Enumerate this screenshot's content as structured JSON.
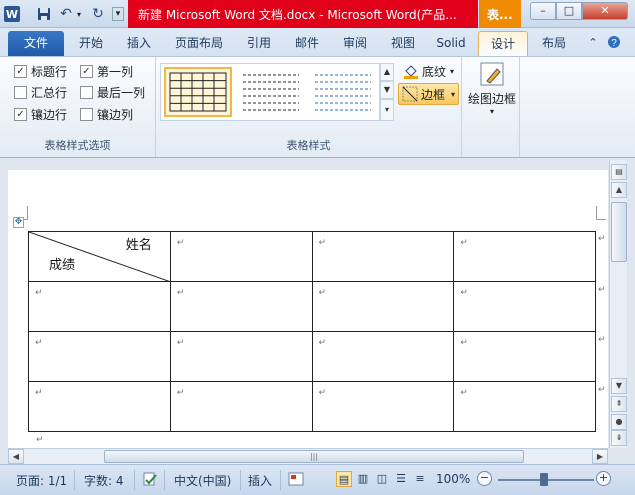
{
  "app": {
    "title": "新建 Microsoft Word 文档.docx - Microsoft Word(产品...",
    "context_tab": "表..."
  },
  "window_controls": {
    "minimize": "–",
    "maximize": "□",
    "close": "✕"
  },
  "quick_access": {
    "more": "▾"
  },
  "tabs": [
    {
      "label": "文件"
    },
    {
      "label": "开始"
    },
    {
      "label": "插入"
    },
    {
      "label": "页面布局"
    },
    {
      "label": "引用"
    },
    {
      "label": "邮件"
    },
    {
      "label": "审阅"
    },
    {
      "label": "视图"
    },
    {
      "label": "Solid"
    },
    {
      "label": "设计"
    },
    {
      "label": "布局"
    }
  ],
  "ribbon": {
    "style_options": {
      "label": "表格样式选项",
      "checkboxes": [
        {
          "label": "标题行",
          "checked": true
        },
        {
          "label": "第一列",
          "checked": true
        },
        {
          "label": "汇总行",
          "checked": false
        },
        {
          "label": "最后一列",
          "checked": false
        },
        {
          "label": "镶边行",
          "checked": true
        },
        {
          "label": "镶边列",
          "checked": false
        }
      ]
    },
    "table_styles": {
      "label": "表格样式",
      "shading_label": "底纹",
      "borders_label": "边框"
    },
    "draw_borders": {
      "label": "绘图边框"
    }
  },
  "document": {
    "header_cell": {
      "name": "姓名",
      "score": "成绩"
    },
    "paragraph_mark": "↵",
    "rows": 4,
    "cols": 4
  },
  "status": {
    "page": "页面: 1/1",
    "words": "字数: 4",
    "language": "中文(中国)",
    "mode": "插入",
    "zoom": "100%",
    "zoom_minus": "−",
    "zoom_plus": "+"
  },
  "colors": {
    "title_red": "#e0001a",
    "context_orange": "#f08a00",
    "file_tab": "#2b5fae"
  }
}
